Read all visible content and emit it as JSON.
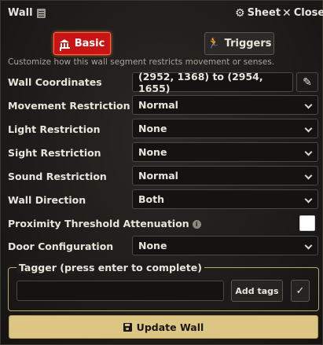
{
  "window": {
    "title": "Wall",
    "sheet_label": "Sheet",
    "close_label": "Close"
  },
  "tabs": {
    "basic_label": "Basic",
    "triggers_label": "Triggers"
  },
  "hint": "Customize how this wall segment restricts movement or senses.",
  "fields": {
    "coordinates": {
      "label": "Wall Coordinates",
      "value": "(2952, 1368) to (2954, 1655)"
    },
    "movement": {
      "label": "Movement Restriction",
      "value": "Normal"
    },
    "light": {
      "label": "Light Restriction",
      "value": "None"
    },
    "sight": {
      "label": "Sight Restriction",
      "value": "None"
    },
    "sound": {
      "label": "Sound Restriction",
      "value": "Normal"
    },
    "direction": {
      "label": "Wall Direction",
      "value": "Both"
    },
    "proximity": {
      "label": "Proximity Threshold Attenuation",
      "checked": false
    },
    "door": {
      "label": "Door Configuration",
      "value": "None"
    }
  },
  "tagger": {
    "legend": "Tagger (press enter to complete)",
    "input_value": "",
    "add_label": "Add tags"
  },
  "footer": {
    "update_label": "Update Wall"
  },
  "colors": {
    "accent_active_tab": "#c81414",
    "update_button": "#ddc683",
    "fieldset_border": "#b8a876"
  }
}
